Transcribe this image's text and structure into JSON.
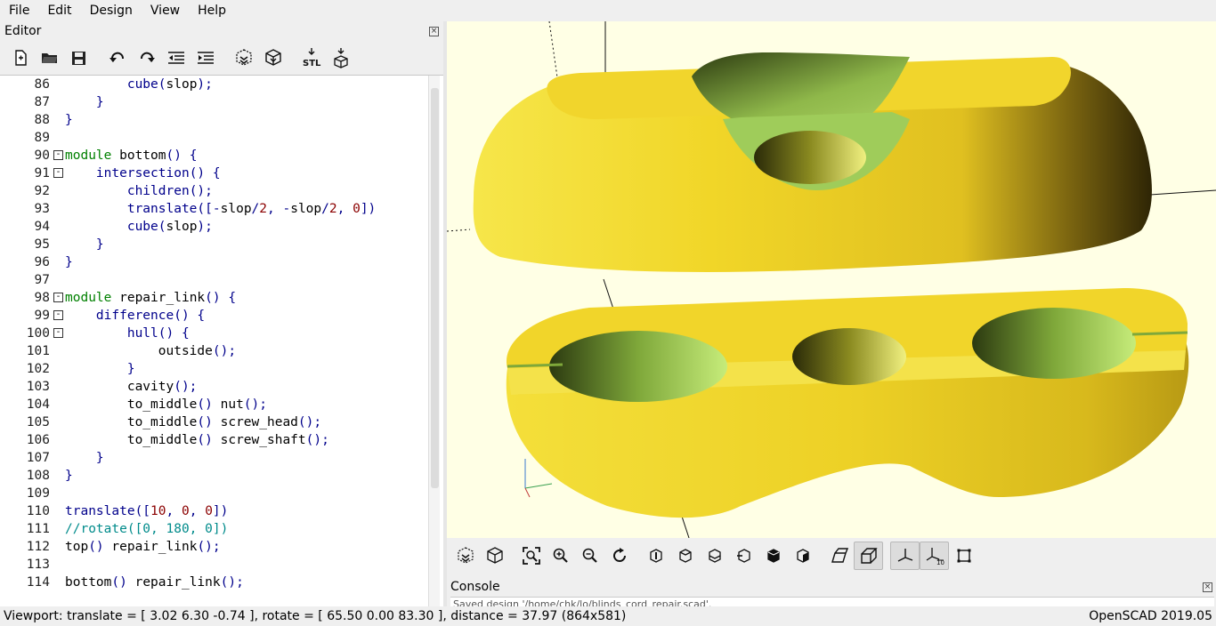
{
  "menu": [
    "File",
    "Edit",
    "Design",
    "View",
    "Help"
  ],
  "editor": {
    "title": "Editor",
    "toolbar": [
      "new-file-icon",
      "open-file-icon",
      "save-file-icon",
      "undo-icon",
      "redo-icon",
      "unindent-icon",
      "indent-icon",
      "preview-icon",
      "render-icon",
      "export-stl-icon",
      "send-to-3d-print-icon"
    ],
    "stl_label": "STL",
    "lines": [
      {
        "n": "86",
        "fold": "",
        "parts": [
          [
            "",
            "        "
          ],
          [
            "fn",
            "cube"
          ],
          [
            "fn",
            "("
          ],
          [
            "",
            "slop"
          ],
          [
            "fn",
            ");"
          ]
        ]
      },
      {
        "n": "87",
        "fold": "",
        "parts": [
          [
            "",
            "    "
          ],
          [
            "fn",
            "}"
          ]
        ]
      },
      {
        "n": "88",
        "fold": "",
        "parts": [
          [
            "fn",
            "}"
          ]
        ]
      },
      {
        "n": "89",
        "fold": "",
        "parts": []
      },
      {
        "n": "90",
        "fold": "-",
        "parts": [
          [
            "kw",
            "module"
          ],
          [
            "",
            " bottom"
          ],
          [
            "fn",
            "() {"
          ]
        ]
      },
      {
        "n": "91",
        "fold": "-",
        "parts": [
          [
            "",
            "    "
          ],
          [
            "fn",
            "intersection"
          ],
          [
            "fn",
            "() {"
          ]
        ]
      },
      {
        "n": "92",
        "fold": "",
        "parts": [
          [
            "",
            "        "
          ],
          [
            "fn",
            "children"
          ],
          [
            "fn",
            "();"
          ]
        ]
      },
      {
        "n": "93",
        "fold": "",
        "parts": [
          [
            "",
            "        "
          ],
          [
            "fn",
            "translate"
          ],
          [
            "fn",
            "([-"
          ],
          [
            "",
            "slop"
          ],
          [
            "fn",
            "/"
          ],
          [
            "num",
            "2"
          ],
          [
            "fn",
            ", -"
          ],
          [
            "",
            "slop"
          ],
          [
            "fn",
            "/"
          ],
          [
            "num",
            "2"
          ],
          [
            "fn",
            ", "
          ],
          [
            "num",
            "0"
          ],
          [
            "fn",
            "])"
          ]
        ]
      },
      {
        "n": "94",
        "fold": "",
        "parts": [
          [
            "",
            "        "
          ],
          [
            "fn",
            "cube"
          ],
          [
            "fn",
            "("
          ],
          [
            "",
            "slop"
          ],
          [
            "fn",
            ");"
          ]
        ]
      },
      {
        "n": "95",
        "fold": "",
        "parts": [
          [
            "",
            "    "
          ],
          [
            "fn",
            "}"
          ]
        ]
      },
      {
        "n": "96",
        "fold": "",
        "parts": [
          [
            "fn",
            "}"
          ]
        ]
      },
      {
        "n": "97",
        "fold": "",
        "parts": []
      },
      {
        "n": "98",
        "fold": "-",
        "parts": [
          [
            "kw",
            "module"
          ],
          [
            "",
            " repair_link"
          ],
          [
            "fn",
            "() {"
          ]
        ]
      },
      {
        "n": "99",
        "fold": "-",
        "parts": [
          [
            "",
            "    "
          ],
          [
            "fn",
            "difference"
          ],
          [
            "fn",
            "() {"
          ]
        ]
      },
      {
        "n": "100",
        "fold": "-",
        "parts": [
          [
            "",
            "        "
          ],
          [
            "fn",
            "hull"
          ],
          [
            "fn",
            "() {"
          ]
        ]
      },
      {
        "n": "101",
        "fold": "",
        "parts": [
          [
            "",
            "            outside"
          ],
          [
            "fn",
            "();"
          ]
        ]
      },
      {
        "n": "102",
        "fold": "",
        "parts": [
          [
            "",
            "        "
          ],
          [
            "fn",
            "}"
          ]
        ]
      },
      {
        "n": "103",
        "fold": "",
        "parts": [
          [
            "",
            "        cavity"
          ],
          [
            "fn",
            "();"
          ]
        ]
      },
      {
        "n": "104",
        "fold": "",
        "parts": [
          [
            "",
            "        to_middle"
          ],
          [
            "fn",
            "()"
          ],
          [
            "",
            " nut"
          ],
          [
            "fn",
            "();"
          ]
        ]
      },
      {
        "n": "105",
        "fold": "",
        "parts": [
          [
            "",
            "        to_middle"
          ],
          [
            "fn",
            "()"
          ],
          [
            "",
            " screw_head"
          ],
          [
            "fn",
            "();"
          ]
        ]
      },
      {
        "n": "106",
        "fold": "",
        "parts": [
          [
            "",
            "        to_middle"
          ],
          [
            "fn",
            "()"
          ],
          [
            "",
            " screw_shaft"
          ],
          [
            "fn",
            "();"
          ]
        ]
      },
      {
        "n": "107",
        "fold": "",
        "parts": [
          [
            "",
            "    "
          ],
          [
            "fn",
            "}"
          ]
        ]
      },
      {
        "n": "108",
        "fold": "",
        "parts": [
          [
            "fn",
            "}"
          ]
        ]
      },
      {
        "n": "109",
        "fold": "",
        "parts": []
      },
      {
        "n": "110",
        "fold": "",
        "parts": [
          [
            "fn",
            "translate"
          ],
          [
            "fn",
            "(["
          ],
          [
            "num",
            "10"
          ],
          [
            "fn",
            ", "
          ],
          [
            "num",
            "0"
          ],
          [
            "fn",
            ", "
          ],
          [
            "num",
            "0"
          ],
          [
            "fn",
            "])"
          ]
        ]
      },
      {
        "n": "111",
        "fold": "",
        "parts": [
          [
            "cmt",
            "//rotate([0, 180, 0])"
          ]
        ]
      },
      {
        "n": "112",
        "fold": "",
        "parts": [
          [
            "",
            "top"
          ],
          [
            "fn",
            "()"
          ],
          [
            "",
            " repair_link"
          ],
          [
            "fn",
            "();"
          ]
        ]
      },
      {
        "n": "113",
        "fold": "",
        "parts": []
      },
      {
        "n": "114",
        "fold": "",
        "parts": [
          [
            "",
            "bottom"
          ],
          [
            "fn",
            "()"
          ],
          [
            "",
            " repair_link"
          ],
          [
            "fn",
            "();"
          ]
        ]
      }
    ]
  },
  "viewport": {
    "model_color": "#f2d22a",
    "cavity_color": "#9bc95a",
    "background": "#ffffe5"
  },
  "view_toolbar": [
    "preview-icon",
    "render-icon",
    "view-all-icon",
    "zoom-in-icon",
    "zoom-out-icon",
    "reset-view-icon",
    "view-right-icon",
    "view-top-icon",
    "view-bottom-icon",
    "view-left-icon",
    "view-front-icon",
    "view-back-icon",
    "perspective-icon",
    "orthogonal-icon",
    "show-axes-icon",
    "show-scale-markers-icon",
    "show-edges-icon"
  ],
  "console": {
    "title": "Console",
    "text": "Saved design '/home/chk/lo/blinds_cord_repair.scad'."
  },
  "status": {
    "viewport": "Viewport: translate = [ 3.02 6.30 -0.74 ], rotate = [ 65.50 0.00 83.30 ], distance = 37.97 (864x581)",
    "app": "OpenSCAD 2019.05"
  }
}
